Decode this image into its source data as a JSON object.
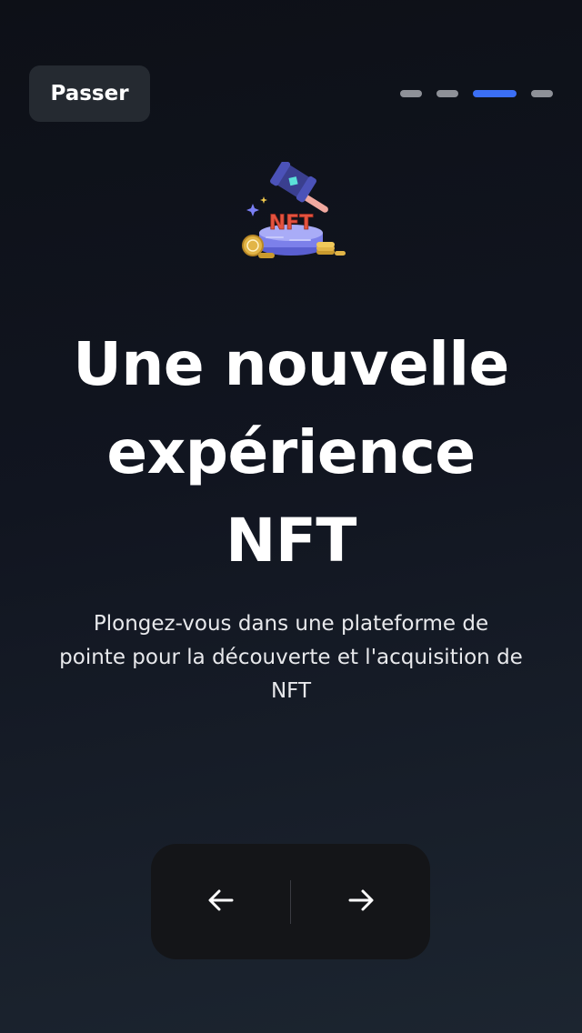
{
  "header": {
    "skip_label": "Passer"
  },
  "pager": {
    "total": 4,
    "current": 3,
    "active_color": "#3b6ff5",
    "inactive_color": "#8e9198"
  },
  "hero": {
    "icon": "nft-auction-gavel-icon",
    "badge_text": "NFT"
  },
  "content": {
    "title_line_1": "Une nouvelle",
    "title_line_2": "expérience",
    "title_line_3": "NFT",
    "subtitle_line_1": "Plongez-vous dans une plateforme de",
    "subtitle_line_2": "pointe pour la découverte et l'acquisition de",
    "subtitle_line_3": "NFT"
  },
  "navigation": {
    "prev_icon": "arrow-left-icon",
    "next_icon": "arrow-right-icon"
  }
}
